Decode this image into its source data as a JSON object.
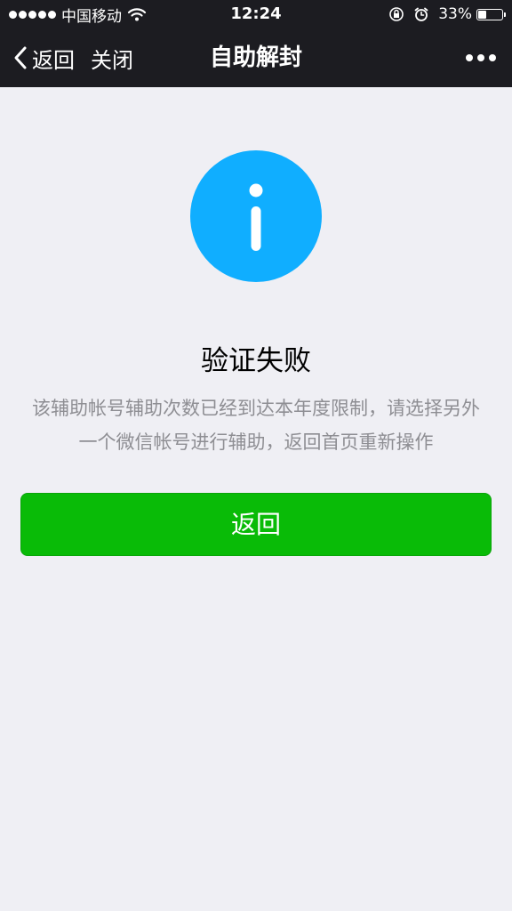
{
  "status_bar": {
    "carrier": "中国移动",
    "time": "12:24",
    "battery_percent": "33%",
    "battery_level": 0.33,
    "icons": [
      "signal-dots-icon",
      "wifi-icon",
      "orientation-lock-icon",
      "alarm-icon",
      "battery-icon"
    ]
  },
  "nav": {
    "back_label": "返回",
    "close_label": "关闭",
    "title": "自助解封",
    "more_icon": "more-dots-icon"
  },
  "result": {
    "icon": "info-icon",
    "icon_color": "#10aeff",
    "title": "验证失败",
    "description": "该辅助帐号辅助次数已经到达本年度限制，请选择另外一个微信帐号进行辅助，返回首页重新操作"
  },
  "actions": {
    "primary_label": "返回",
    "primary_color": "#09bb07"
  },
  "colors": {
    "header_bg": "#1c1c21",
    "page_bg": "#efeff4"
  }
}
